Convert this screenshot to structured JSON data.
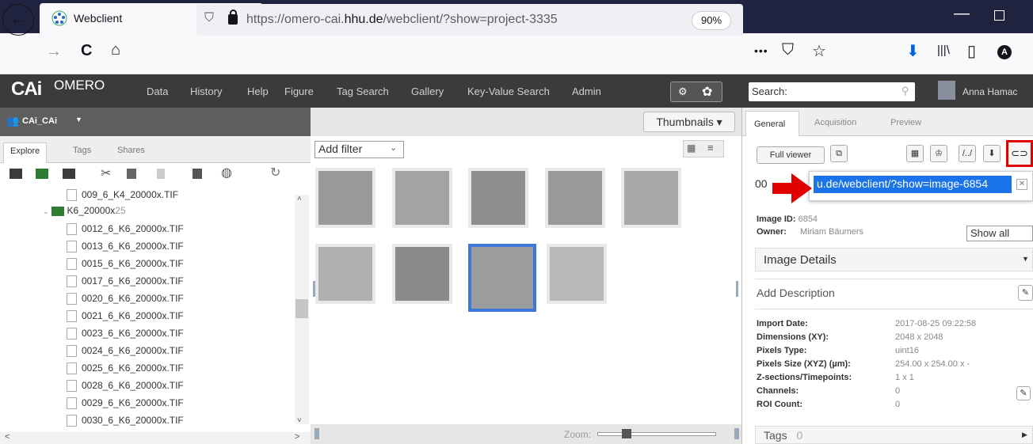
{
  "browser": {
    "tab_title": "Webclient",
    "tab_close": "×",
    "new_tab": "+",
    "window_minimize": "—",
    "back": "←",
    "forward": "→",
    "reload": "C",
    "home": "⌂",
    "url_prefix": "https://omero-cai.",
    "url_domain": "hhu.de",
    "url_suffix": "/webclient/?show=project-3335",
    "zoom": "90%",
    "more": "•••",
    "pocket": "⛉",
    "star": "☆",
    "download": "⬇",
    "library": "|||\\",
    "sidebar": "▯",
    "account": "A"
  },
  "header": {
    "logo": "CAi",
    "product": "OMERO",
    "menu": [
      "Data",
      "History",
      "Help",
      "Figure",
      "Tag Search",
      "Gallery",
      "Key-Value Search",
      "Admin"
    ],
    "search_placeholder": "Search:",
    "user": "Anna Hamac"
  },
  "left": {
    "group": "CAi_CAi",
    "tabs": [
      "Explore",
      "Tags",
      "Shares"
    ],
    "tree": [
      {
        "label": "009_6_K4_20000x.TIF",
        "type": "file"
      },
      {
        "label": "K6_20000x",
        "count": "25",
        "type": "folder"
      },
      {
        "label": "0012_6_K6_20000x.TIF",
        "type": "file"
      },
      {
        "label": "0013_6_K6_20000x.TIF",
        "type": "file"
      },
      {
        "label": "0015_6_K6_20000x.TIF",
        "type": "file"
      },
      {
        "label": "0017_6_K6_20000x.TIF",
        "type": "file"
      },
      {
        "label": "0020_6_K6_20000x.TIF",
        "type": "file"
      },
      {
        "label": "0021_6_K6_20000x.TIF",
        "type": "file"
      },
      {
        "label": "0023_6_K6_20000x.TIF",
        "type": "file"
      },
      {
        "label": "0024_6_K6_20000x.TIF",
        "type": "file"
      },
      {
        "label": "0025_6_K6_20000x.TIF",
        "type": "file"
      },
      {
        "label": "0028_6_K6_20000x.TIF",
        "type": "file"
      },
      {
        "label": "0029_6_K6_20000x.TIF",
        "type": "file"
      },
      {
        "label": "0030_6_K6_20000x.TIF",
        "type": "file"
      }
    ]
  },
  "center": {
    "view_select": "Thumbnails ▾",
    "filter": "Add filter",
    "zoom_label": "Zoom:"
  },
  "right": {
    "tabs": [
      "General",
      "Acquisition",
      "Preview"
    ],
    "full_viewer": "Full viewer",
    "link_text": "u.de/webclient/?show=image-6854",
    "name_prefix": "00",
    "image_id_label": "Image ID:",
    "image_id": "6854",
    "owner_label": "Owner:",
    "owner": "Miriam Bäumers",
    "show_all": "Show all",
    "image_details": "Image Details",
    "add_description": "Add Description",
    "meta": [
      {
        "k": "Import Date:",
        "v": "2017-08-25 09:22:58"
      },
      {
        "k": "Dimensions (XY):",
        "v": "2048 x 2048"
      },
      {
        "k": "Pixels Type:",
        "v": "uint16"
      },
      {
        "k": "Pixels Size (XYZ) (µm):",
        "v": "254.00 x 254.00 x -"
      },
      {
        "k": "Z-sections/Timepoints:",
        "v": "1 x 1"
      },
      {
        "k": "Channels:",
        "v": "0"
      },
      {
        "k": "ROI Count:",
        "v": "0"
      }
    ],
    "tags_label": "Tags",
    "tags_count": "0"
  }
}
